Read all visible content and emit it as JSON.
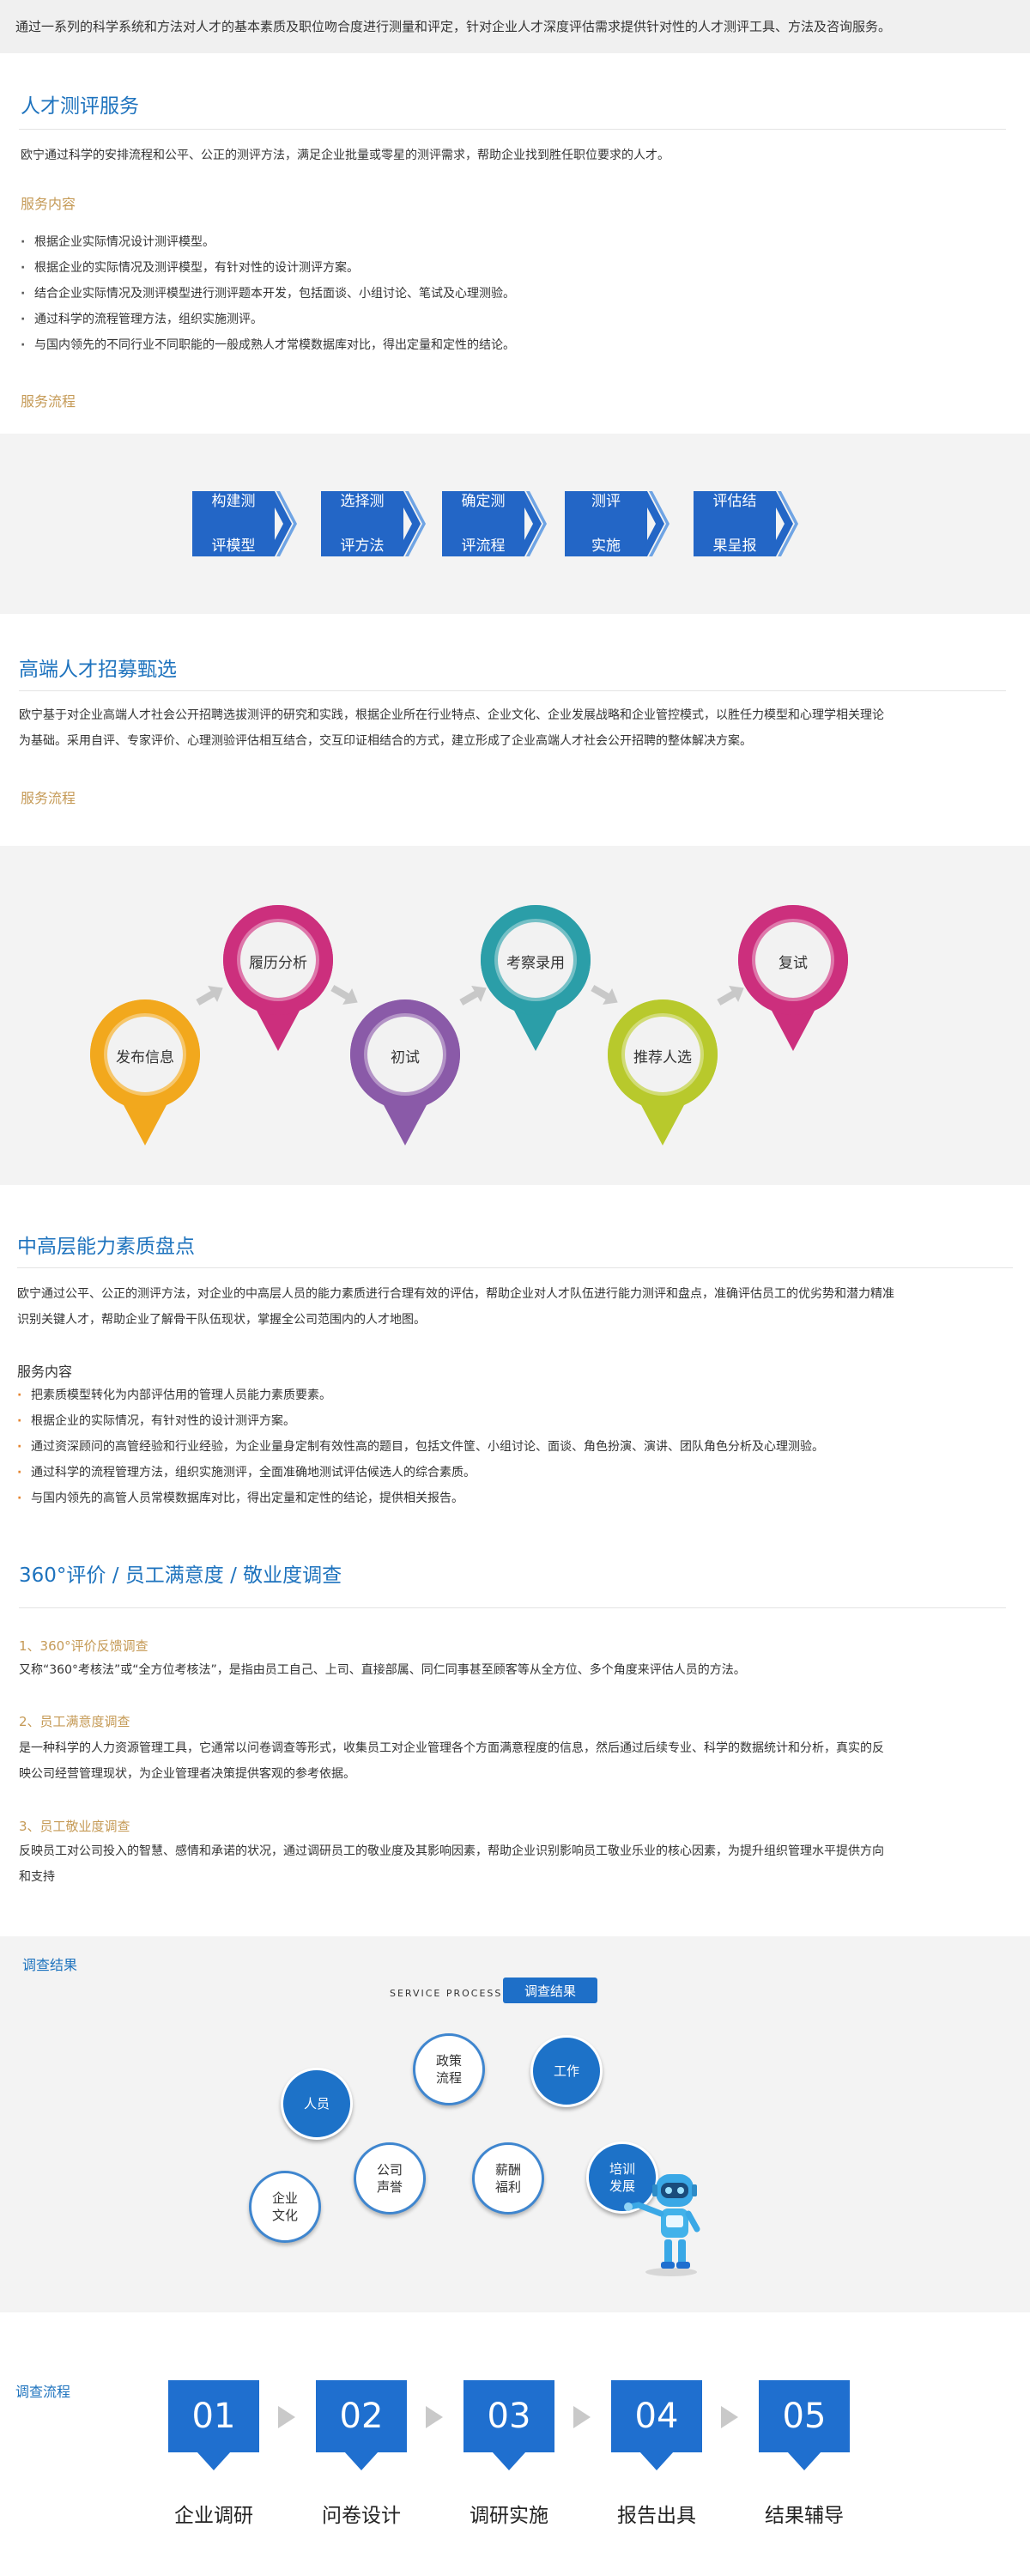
{
  "intro": "通过一系列的科学系统和方法对人才的基本素质及职位吻合度进行测量和评定，针对企业人才深度评估需求提供针对性的人才测评工具、方法及咨询服务。",
  "section1": {
    "title": "人才测评服务",
    "desc": "欧宁通过科学的安排流程和公平、公正的测评方法，满足企业批量或零星的测评需求，帮助企业找到胜任职位要求的人才。",
    "content_heading": "服务内容",
    "items": [
      "根据企业实际情况设计测评模型。",
      "根据企业的实际情况及测评模型，有针对性的设计测评方案。",
      "结合企业实际情况及测评模型进行测评题本开发，包括面谈、小组讨论、笔试及心理测验。",
      "通过科学的流程管理方法，组织实施测评。",
      "与国内领先的不同行业不同职能的一般成熟人才常模数据库对比，得出定量和定性的结论。"
    ],
    "process_heading": "服务流程",
    "steps": [
      {
        "l1": "构建测",
        "l2": "评模型"
      },
      {
        "l1": "选择测",
        "l2": "评方法"
      },
      {
        "l1": "确定测",
        "l2": "评流程"
      },
      {
        "l1": "测评",
        "l2": "实施"
      },
      {
        "l1": "评估结",
        "l2": "果呈报"
      }
    ],
    "step_color": "#2366c6"
  },
  "section2": {
    "title": "高端人才招募甄选",
    "desc1": "欧宁基于对企业高端人才社会公开招聘选拔测评的研究和实践，根据企业所在行业特点、企业文化、企业发展战略和企业管控模式，以胜任力模型和心理学相关理论",
    "desc2": "为基础。采用自评、专家评价、心理测验评估相互结合，交互印证相结合的方式，建立形成了企业高端人才社会公开招聘的整体解决方案。",
    "process_heading": "服务流程",
    "pins": [
      {
        "label": "发布信息",
        "color": "#f2a81d"
      },
      {
        "label": "履历分析",
        "color": "#cc2f7d"
      },
      {
        "label": "初试",
        "color": "#8a5aa8"
      },
      {
        "label": "考察录用",
        "color": "#2b9ea8"
      },
      {
        "label": "推荐人选",
        "color": "#b8c92c"
      },
      {
        "label": "复试",
        "color": "#cc2f7d"
      }
    ]
  },
  "section3": {
    "title": "中高层能力素质盘点",
    "desc1": "欧宁通过公平、公正的测评方法，对企业的中高层人员的能力素质进行合理有效的评估，帮助企业对人才队伍进行能力测评和盘点，准确评估员工的优劣势和潜力精准",
    "desc2": "识别关键人才，帮助企业了解骨干队伍现状，掌握全公司范围内的人才地图。",
    "content_heading": "服务内容",
    "items": [
      "把素质模型转化为内部评估用的管理人员能力素质要素。",
      "根据企业的实际情况，有针对性的设计测评方案。",
      "通过资深顾问的高管经验和行业经验，为企业量身定制有效性高的题目，包括文件筐、小组讨论、面谈、角色扮演、演讲、团队角色分析及心理测验。",
      "通过科学的流程管理方法，组织实施测评，全面准确地测试评估候选人的综合素质。",
      "与国内领先的高管人员常模数据库对比，得出定量和定性的结论，提供相关报告。"
    ]
  },
  "section4": {
    "title": "360°评价 / 员工满意度 / 敬业度调查",
    "sub1_heading": "1、360°评价反馈调查",
    "sub1_desc": "又称“360°考核法”或“全方位考核法”，是指由员工自己、上司、直接部属、同仁同事甚至顾客等从全方位、多个角度来评估人员的方法。",
    "sub2_heading": "2、员工满意度调查",
    "sub2_desc1": "是一种科学的人力资源管理工具，它通常以问卷调查等形式，收集员工对企业管理各个方面满意程度的信息，然后通过后续专业、科学的数据统计和分析，真实的反",
    "sub2_desc2": "映公司经营管理现状，为企业管理者决策提供客观的参考依据。",
    "sub3_heading": "3、员工敬业度调查",
    "sub3_desc1": "反映员工对公司投入的智慧、感情和承诺的状况，通过调研员工的敬业度及其影响因素，帮助企业识别影响员工敬业乐业的核心因素，为提升组织管理水平提供方向",
    "sub3_desc2": "和支持"
  },
  "results": {
    "heading": "调查结果",
    "service_process": "SERVICE PROCESS",
    "badge": "调查结果",
    "circles": [
      {
        "l1": "政策",
        "l2": "流程"
      },
      {
        "l1": "工作",
        "l2": ""
      },
      {
        "l1": "人员",
        "l2": ""
      },
      {
        "l1": "公司",
        "l2": "声誉"
      },
      {
        "l1": "薪酬",
        "l2": "福利"
      },
      {
        "l1": "培训",
        "l2": "发展"
      },
      {
        "l1": "企业",
        "l2": "文化"
      }
    ]
  },
  "flow": {
    "heading": "调查流程",
    "steps": [
      {
        "num": "01",
        "label": "企业调研"
      },
      {
        "num": "02",
        "label": "问卷设计"
      },
      {
        "num": "03",
        "label": "调研实施"
      },
      {
        "num": "04",
        "label": "报告出具"
      },
      {
        "num": "05",
        "label": "结果辅导"
      }
    ],
    "color": "#1f6fcf"
  }
}
